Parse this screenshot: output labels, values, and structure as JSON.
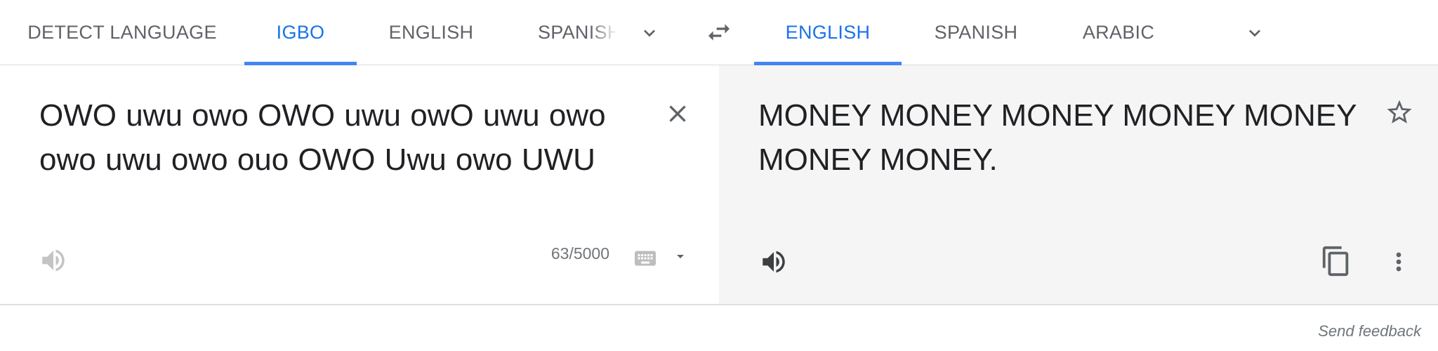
{
  "source_languages": {
    "tabs": [
      {
        "label": "DETECT LANGUAGE"
      },
      {
        "label": "IGBO"
      },
      {
        "label": "ENGLISH"
      },
      {
        "label": "SPANISH"
      }
    ],
    "active": "IGBO",
    "more_icon": "chevron-down-icon"
  },
  "swap_icon": "swap-arrows-icon",
  "target_languages": {
    "tabs": [
      {
        "label": "ENGLISH"
      },
      {
        "label": "SPANISH"
      },
      {
        "label": "ARABIC"
      }
    ],
    "active": "ENGLISH",
    "more_icon": "chevron-down-icon"
  },
  "source": {
    "text": "OWO uwu owo OWO uwu owO uwu owo owo uwu owo ouo OWO Uwu owo UWU",
    "char_count": "63/5000",
    "icons": [
      "speaker-icon",
      "close-icon",
      "keyboard-icon",
      "caret-down-icon"
    ]
  },
  "target": {
    "text": "MONEY MONEY MONEY MONEY MONEY MONEY MONEY.",
    "icons": [
      "star-icon",
      "speaker-icon",
      "copy-icon",
      "more-vert-icon"
    ]
  },
  "footer": {
    "feedback_label": "Send feedback"
  },
  "colors": {
    "accent": "#1a73e8",
    "active_underline": "#4285f4",
    "target_bg": "#f5f5f5",
    "muted_text": "#5f6368"
  }
}
